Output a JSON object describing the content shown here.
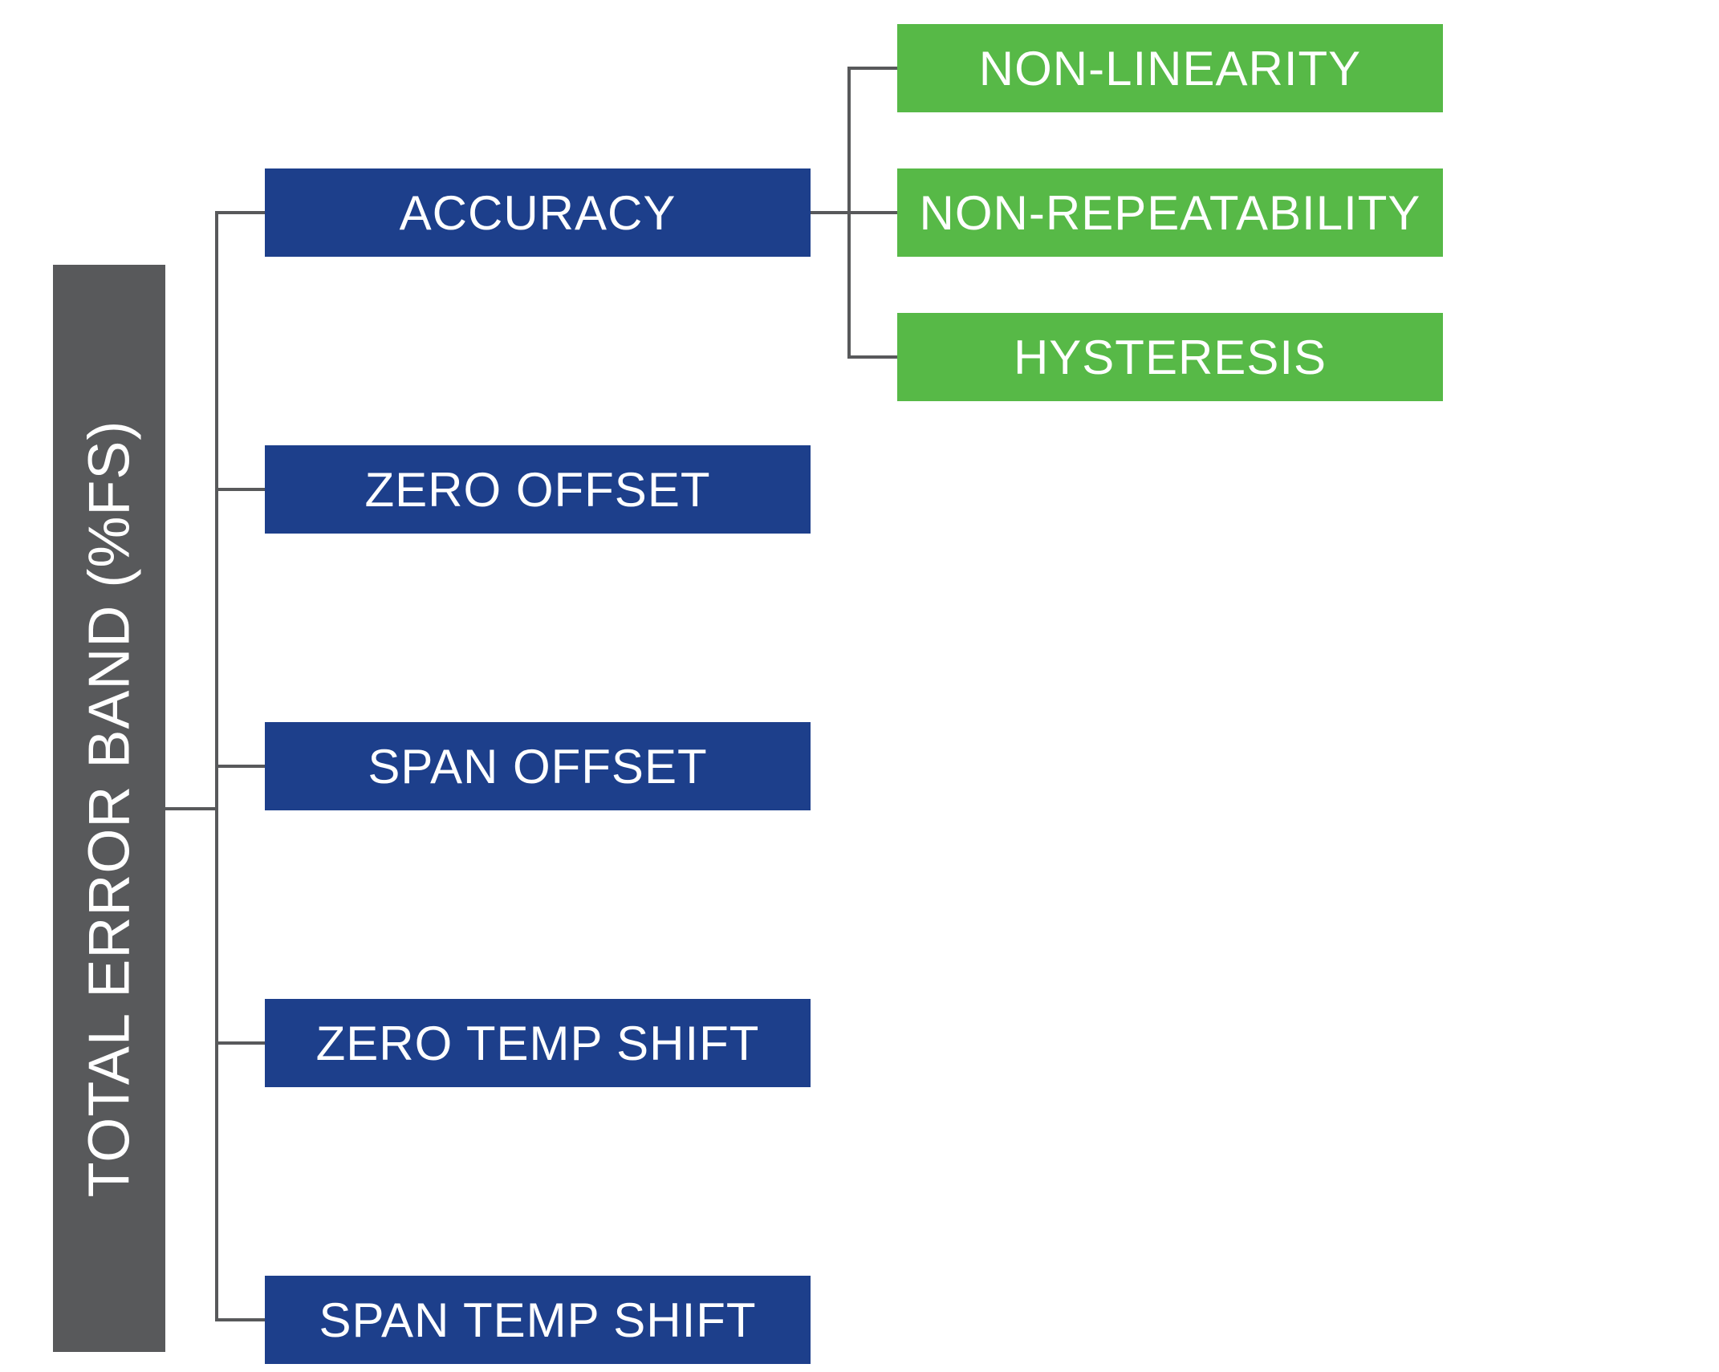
{
  "root": {
    "label": "TOTAL ERROR BAND (%FS)"
  },
  "mid": [
    {
      "label": "ACCURACY"
    },
    {
      "label": "ZERO OFFSET"
    },
    {
      "label": "SPAN OFFSET"
    },
    {
      "label": "ZERO TEMP SHIFT"
    },
    {
      "label": "SPAN TEMP SHIFT"
    }
  ],
  "leaf": [
    {
      "label": "NON-LINEARITY"
    },
    {
      "label": "NON-REPEATABILITY"
    },
    {
      "label": "HYSTERESIS"
    }
  ],
  "colors": {
    "root": "#58595b",
    "mid": "#1d3f8b",
    "leaf": "#57b947",
    "line": "#58595b"
  }
}
